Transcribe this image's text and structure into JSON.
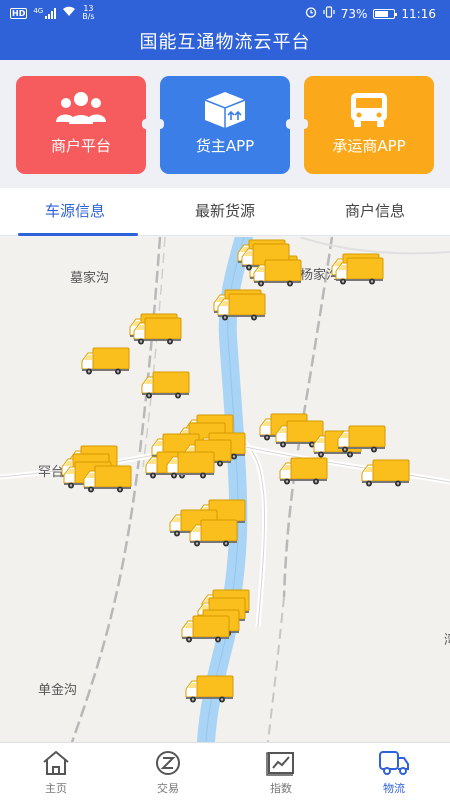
{
  "status": {
    "hd": "HD",
    "net_type": "4G",
    "speed_value": "13",
    "speed_unit": "B/s",
    "battery_percent": "73%",
    "battery_level": 0.73,
    "time": "11:16"
  },
  "header": {
    "title": "国能互通物流云平台"
  },
  "cards": [
    {
      "label": "商户平台",
      "color": "#f65b5d",
      "icon": "users-icon"
    },
    {
      "label": "货主APP",
      "color": "#3b7ee8",
      "icon": "package-icon"
    },
    {
      "label": "承运商APP",
      "color": "#fba81b",
      "icon": "truck-front-icon"
    }
  ],
  "tabs": [
    {
      "label": "车源信息",
      "active": true
    },
    {
      "label": "最新货源",
      "active": false
    },
    {
      "label": "商户信息",
      "active": false
    }
  ],
  "map": {
    "places": [
      "墓家沟",
      "杨家沟",
      "罕台",
      "单金沟",
      "湾"
    ],
    "truck_count": 37,
    "colors": {
      "river": "#a9d4f5",
      "road": "#b8b8b8",
      "truck_body": "#fbbf1d",
      "truck_cab": "#ffffff"
    }
  },
  "bottom_nav": [
    {
      "label": "主页",
      "icon": "home-icon",
      "active": false
    },
    {
      "label": "交易",
      "icon": "exchange-icon",
      "active": false
    },
    {
      "label": "指数",
      "icon": "index-chart-icon",
      "active": false
    },
    {
      "label": "物流",
      "icon": "logistics-truck-icon",
      "active": true
    }
  ],
  "accent": "#2f62d9"
}
